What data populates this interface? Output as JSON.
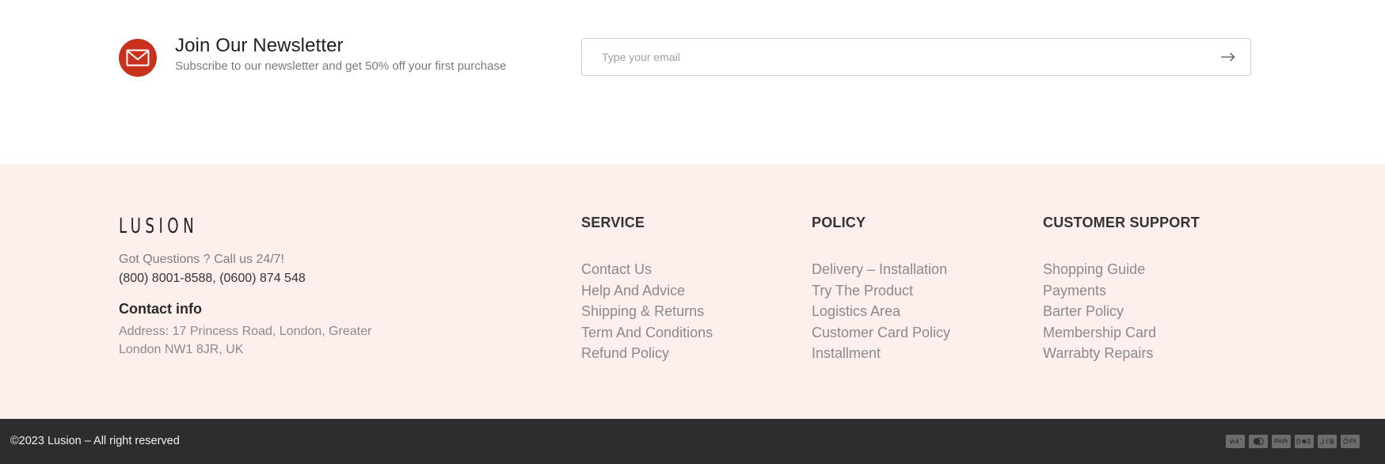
{
  "newsletter": {
    "icon": "envelope-icon",
    "title": "Join Our Newsletter",
    "subtitle": "Subscribe to our newsletter and get 50% off your first purchase",
    "email_placeholder": "Type your email",
    "submit_icon": "arrow-right-icon",
    "accent_color": "#c8321c"
  },
  "footer": {
    "logo": "LUSION",
    "questions": "Got Questions ? Call us 24/7!",
    "phones": "(800) 8001-8588, (0600) 874 548",
    "contact_title": "Contact info",
    "address": "Address: 17 Princess Road, London, Greater London NW1 8JR, UK",
    "background_color": "#fdf0ec",
    "columns": [
      {
        "title": "SERVICE",
        "items": [
          "Contact Us",
          "Help And Advice",
          "Shipping & Returns",
          "Term And Conditions",
          "Refund Policy"
        ]
      },
      {
        "title": "POLICY",
        "items": [
          "Delivery – Installation",
          "Try The Product",
          "Logistics Area",
          "Customer Card Policy",
          "Installment"
        ]
      },
      {
        "title": "CUSTOMER SUPPORT",
        "items": [
          "Shopping Guide",
          "Payments",
          "Barter Policy",
          "Membership Card",
          "Warrabty Repairs"
        ]
      }
    ]
  },
  "bottom": {
    "copyright": "©2023 Lusion – All right reserved",
    "background_color": "#2d2d2d",
    "payment_icons": [
      "visa-icon",
      "mastercard-icon",
      "paypal-icon",
      "discover-icon",
      "jcb-icon",
      "apple-pay-icon"
    ]
  }
}
